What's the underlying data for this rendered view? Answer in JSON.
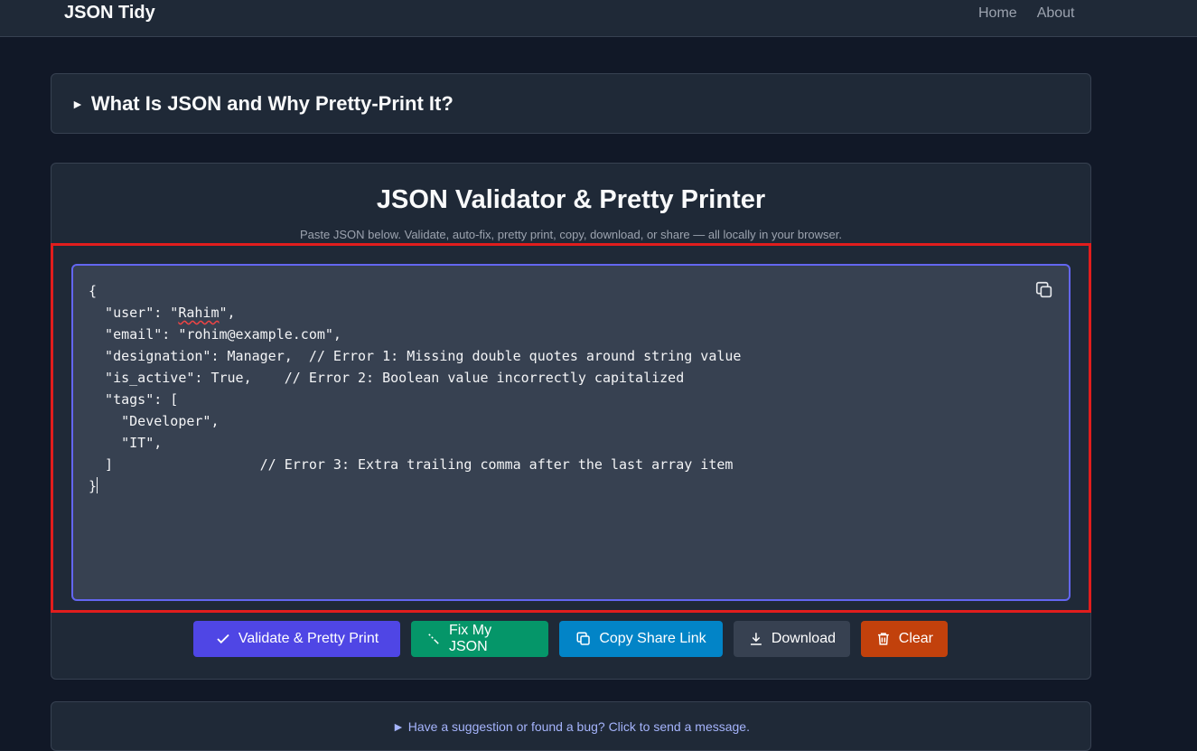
{
  "nav": {
    "brand": "JSON Tidy",
    "links": [
      "Home",
      "About"
    ]
  },
  "faq": {
    "marker": "►",
    "title": "What Is JSON and Why Pretty-Print It?"
  },
  "main": {
    "title": "JSON Validator & Pretty Printer",
    "subtitle": "Paste JSON below. Validate, auto-fix, pretty print, copy, download, or share — all locally in your browser."
  },
  "editor": {
    "lines": [
      "{",
      "  \"user\": \"Rahim\",",
      "  \"email\": \"rohim@example.com\",",
      "  \"designation\": Manager,  // Error 1: Missing double quotes around string value",
      "  \"is_active\": True,    // Error 2: Boolean value incorrectly capitalized",
      "  \"tags\": [",
      "    \"Developer\",",
      "    \"IT\",",
      "  ]                  // Error 3: Extra trailing comma after the last array item",
      "}"
    ],
    "copy_icon": "copy-icon"
  },
  "buttons": {
    "validate": "Validate & Pretty Print",
    "fix": "Fix My JSON",
    "share": "Copy Share Link",
    "download": "Download",
    "clear": "Clear"
  },
  "feedback": {
    "text": "► Have a suggestion or found a bug? Click to send a message."
  },
  "colors": {
    "background": "#111827",
    "card": "#1f2937",
    "editor_border": "#6366f1",
    "highlight": "#e11d1d",
    "validate": "#4f46e5",
    "fix": "#059669",
    "share": "#0284c7",
    "download": "#374151",
    "clear": "#c2410c"
  }
}
